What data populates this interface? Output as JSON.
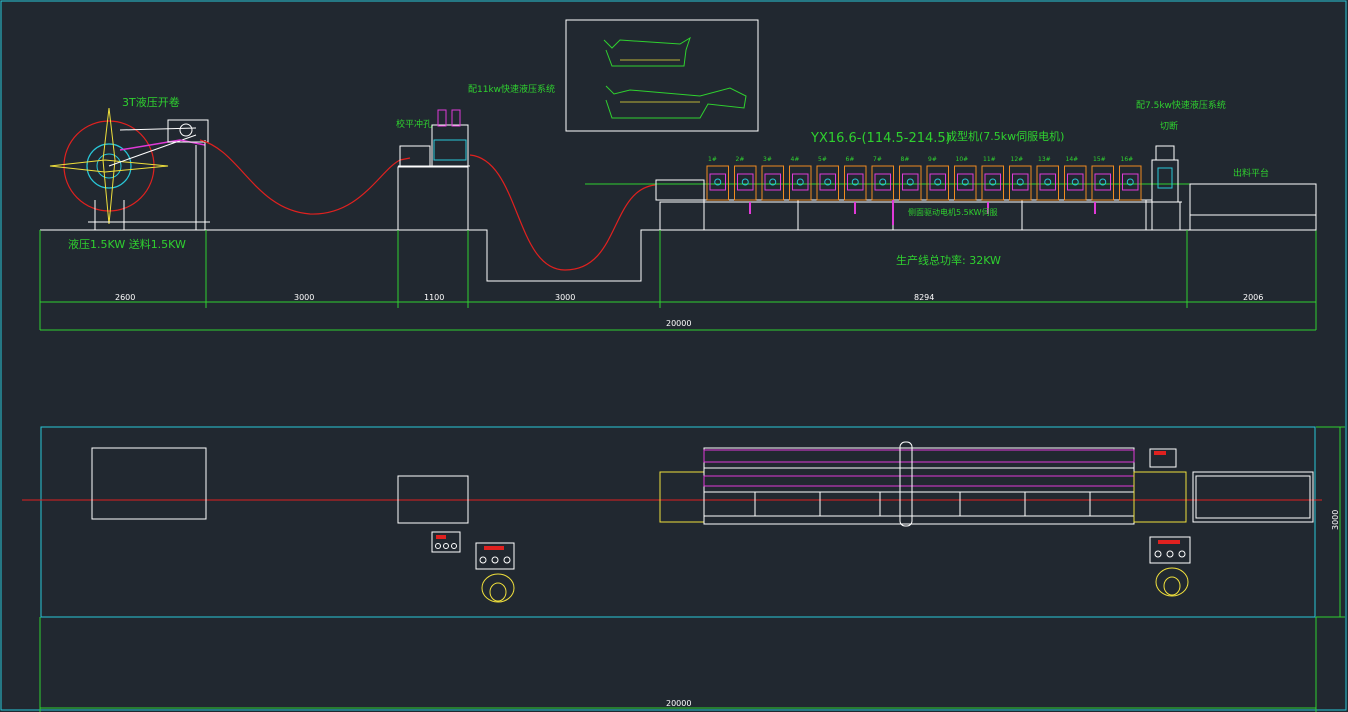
{
  "labels": {
    "uncoiler": "3T液压开卷",
    "uncoiler_power": "液压1.5KW  送料1.5KW",
    "hyd_station_1": "配11kw快速液压系统",
    "leveler": "校平冲孔",
    "main_title": "YX16.6-(114.5-214.5)",
    "main_motor": "成型机(7.5kw伺服电机)",
    "hyd_station_2": "配7.5kw快速液压系统",
    "cutting": "切断",
    "runout": "出料平台",
    "sub_motor": "侧面驱动电机5.5KW伺服",
    "total_power": "生产线总功率: 32KW"
  },
  "dimensions": {
    "d1": "2600",
    "d2": "3000",
    "d3": "1100",
    "d4": "3000",
    "d5": "8294",
    "d6": "2006",
    "total_top": "20000",
    "total_bottom": "20000",
    "width_side": "3000"
  },
  "stations": [
    "1#",
    "2#",
    "3#",
    "4#",
    "5#",
    "6#",
    "7#",
    "8#",
    "9#",
    "10#",
    "11#",
    "12#",
    "13#",
    "14#",
    "15#",
    "16#"
  ],
  "colors": {
    "background": "#212830",
    "lines": "#ffffff",
    "dimension": "#2fd12f",
    "cyan": "#29c8d8",
    "red": "#e0211f",
    "magenta": "#e03ad8",
    "yellow": "#f0e03c",
    "orange": "#f08a20"
  }
}
